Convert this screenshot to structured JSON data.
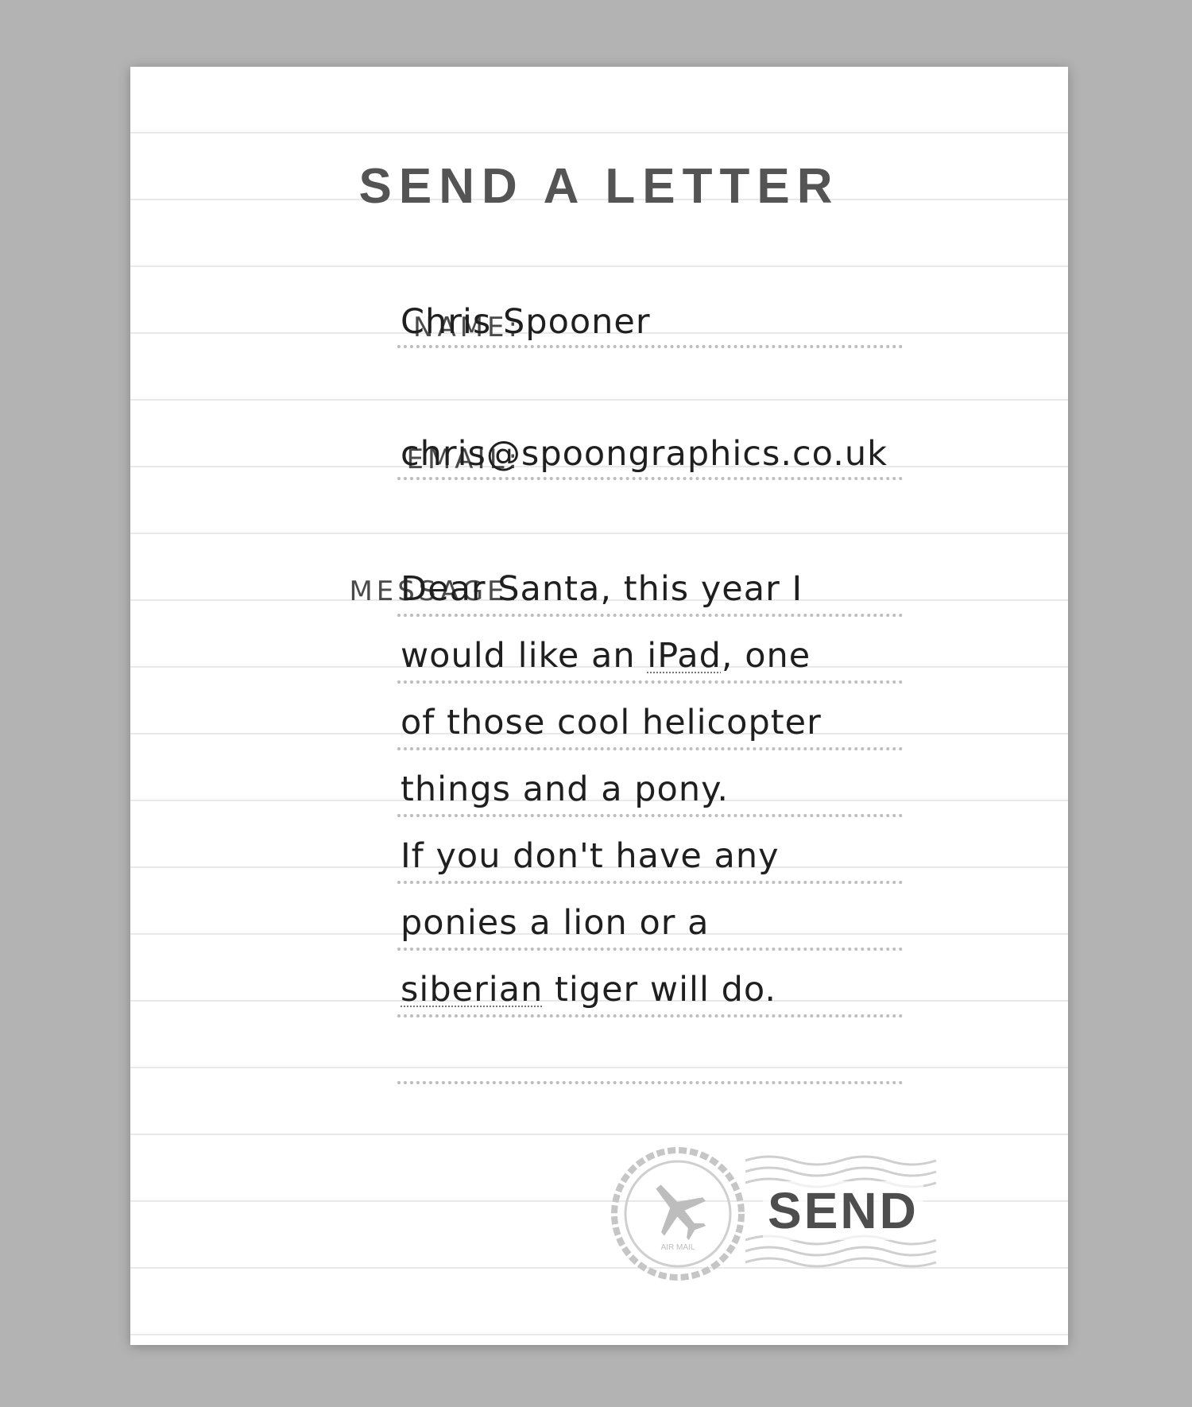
{
  "form": {
    "title": "SEND A LETTER",
    "name_label": "NAME:",
    "name_value": "Chris Spooner",
    "email_label": "EMAIL:",
    "email_value": "chris@spoongraphics.co.uk",
    "message_label": "MESSAGE:",
    "message_lines": [
      {
        "before": "Dear Santa, this year I",
        "spell": "",
        "after": ""
      },
      {
        "before": "would like an ",
        "spell": "iPad",
        "after": ", one"
      },
      {
        "before": "of those cool helicopter",
        "spell": "",
        "after": ""
      },
      {
        "before": "things and a pony.",
        "spell": "",
        "after": ""
      },
      {
        "before": "If you don't have any",
        "spell": "",
        "after": ""
      },
      {
        "before": "ponies a lion or a",
        "spell": "",
        "after": ""
      },
      {
        "before": "",
        "spell": "siberian",
        "after": " tiger will do."
      },
      {
        "before": "",
        "spell": "",
        "after": ""
      }
    ],
    "send_label": "SEND",
    "stamp_icon": "airplane-icon",
    "stamp_text": "AIR MAIL"
  }
}
